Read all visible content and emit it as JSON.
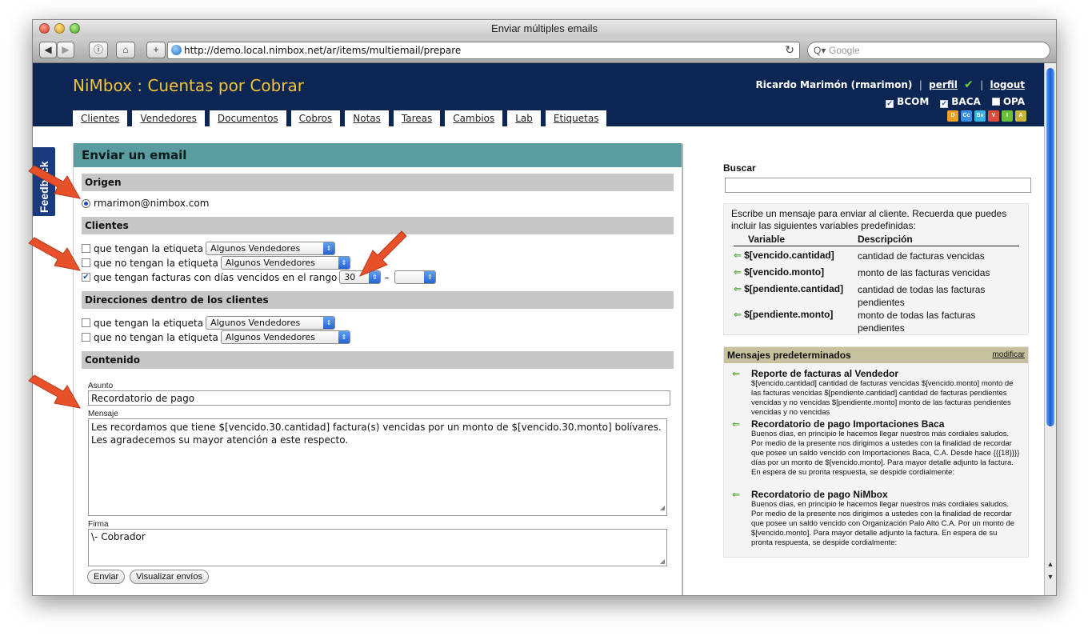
{
  "window": {
    "title": "Enviar múltiples emails"
  },
  "browser": {
    "url": "http://demo.local.nimbox.net/ar/items/multiemail/prepare",
    "search_placeholder": "Google"
  },
  "header": {
    "app_title": "NiMbox : Cuentas por Cobrar",
    "user": "Ricardo Marimón (rmarimon)",
    "perfil": "perfil",
    "logout": "logout",
    "companies": [
      {
        "label": "BCOM",
        "checked": true
      },
      {
        "label": "BACA",
        "checked": true
      },
      {
        "label": "OPA",
        "checked": false
      }
    ],
    "badges": [
      {
        "label": "D",
        "color": "#f0a020"
      },
      {
        "label": "Cc",
        "color": "#3a8ee6"
      },
      {
        "label": "Bx",
        "color": "#3ab0e6"
      },
      {
        "label": "V",
        "color": "#e04a3a"
      },
      {
        "label": "I",
        "color": "#6bbf3a"
      },
      {
        "label": "A",
        "color": "#c9b23a"
      }
    ]
  },
  "tabs": [
    "Clientes",
    "Vendedores",
    "Documentos",
    "Cobros",
    "Notas",
    "Tareas",
    "Cambios",
    "Lab",
    "Etiquetas"
  ],
  "feedback": "Feedback",
  "form": {
    "title": "Enviar un email",
    "origen": {
      "heading": "Origen",
      "email": "rmarimon@nimbox.com"
    },
    "clientes": {
      "heading": "Clientes",
      "opt1": "que tengan la etiqueta",
      "opt2": "que no tengan la etiqueta",
      "opt3": "que tengan facturas con días vencidos en el rango",
      "select_value": "Algunos Vendedores",
      "range_from": "30",
      "range_dash": "–"
    },
    "direcciones": {
      "heading": "Direcciones dentro de los clientes",
      "opt1": "que tengan la etiqueta",
      "opt2": "que no tengan la etiqueta",
      "select_value": "Algunos Vendedores"
    },
    "contenido": {
      "heading": "Contenido",
      "asunto_label": "Asunto",
      "asunto": "Recordatorio de pago",
      "mensaje_label": "Mensaje",
      "mensaje": "Les recordamos que tiene $[vencido.30.cantidad] factura(s) vencidas por un monto de $[vencido.30.monto] bolívares.  Les agradecemos su mayor atención a este respecto.",
      "firma_label": "Firma",
      "firma": "\\- Cobrador"
    },
    "buttons": {
      "enviar": "Enviar",
      "visualizar": "Visualizar envíos"
    }
  },
  "sidebar": {
    "buscar": "Buscar",
    "intro": "Escribe un mensaje para enviar al cliente. Recuerda que puedes incluir las siguientes variables predefinidas:",
    "col_variable": "Variable",
    "col_descripcion": "Descripción",
    "variables": [
      {
        "name": "$[vencido.cantidad]",
        "desc": "cantidad de facturas vencidas"
      },
      {
        "name": "$[vencido.monto]",
        "desc": "monto de las facturas vencidas"
      },
      {
        "name": "$[pendiente.cantidad]",
        "desc": "cantidad de todas las facturas pendientes"
      },
      {
        "name": "$[pendiente.monto]",
        "desc": "monto de todas las facturas pendientes"
      }
    ],
    "mensajes_heading": "Mensajes predeterminados",
    "modificar": "modificar",
    "mensajes": [
      {
        "title": "Reporte de facturas al Vendedor",
        "body": "$[vencido.cantidad] cantidad de facturas vencidas $[vencido.monto] monto de las facturas vencidas $[pendiente.cantidad] cantidad de facturas pendientes vencidas y no vencidas $[pendiente.monto] monto de las facturas pendientes vencidas y no vencidas"
      },
      {
        "title": "Recordatorio de pago Importaciones Baca",
        "body": "Buenos días, en principio le hacemos llegar nuestros más cordiales saludos. Por medio de la presente nos dirigimos a ustedes con la finalidad de recordar que posee un saldo vencido con Importaciones Baca, C.A. Desde hace {{{18}}}} días por un monto de $[vencido.monto]. Para mayor detalle adjunto la factura. En espera de su pronta respuesta, se despide cordialmente:"
      },
      {
        "title": "Recordatorio de pago NiMbox",
        "body": "Buenos días, en principio le hacemos llegar nuestros más cordiales saludos. Por medio de la presente nos dirigimos a ustedes con la finalidad de recordar que posee un saldo vencido con Organización Palo Alto C.A. Por un monto de $[vencido.monto]. Para mayor detalle adjunto la factura. En espera de su pronta respuesta, se despide cordialmente:"
      }
    ]
  },
  "colors": {
    "header_bg": "#0c2653",
    "brand_yellow": "#f4c234",
    "card_head": "#5b9ca1",
    "annotation_arrow": "#e8502a"
  }
}
